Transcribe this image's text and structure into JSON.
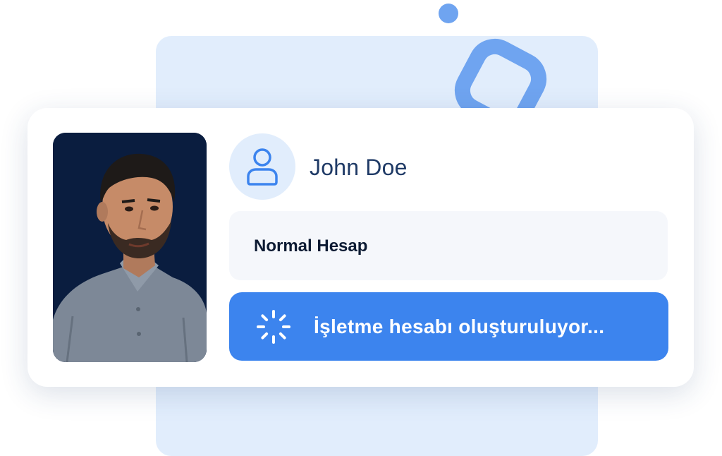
{
  "profile": {
    "name": "John Doe",
    "photo_alt": "user-portrait"
  },
  "account": {
    "type_label": "Normal Hesap"
  },
  "action": {
    "label": "İşletme hesabı oluşturuluyor..."
  },
  "icons": {
    "avatar": "user-icon",
    "loading": "spinner-icon"
  },
  "colors": {
    "accent": "#3c84ee",
    "panel": "#e1edfc",
    "title_text": "#1f3a66",
    "photo_bg": "#0a1d3f"
  }
}
